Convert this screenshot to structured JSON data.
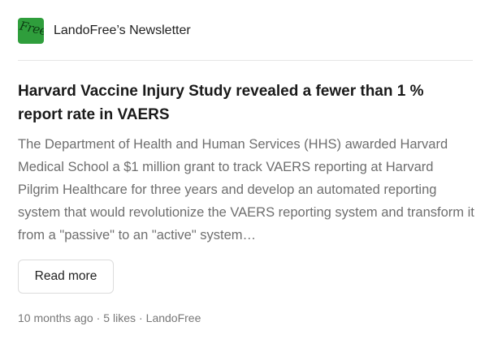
{
  "publication": {
    "logo_text": "Free",
    "name": "LandoFree’s Newsletter"
  },
  "post": {
    "title": "Harvard Vaccine Injury Study revealed a fewer than 1 % report rate in VAERS",
    "excerpt": "The Department of Health and Human Services (HHS) awarded Harvard Medical School a $1 million grant to track VAERS reporting at Harvard Pilgrim Healthcare for three years and develop an automated reporting system that would revolutionize the VAERS reporting system and transform it from a \"passive\" to an \"active\" system…",
    "read_more_label": "Read more",
    "meta": {
      "time": "10 months ago",
      "separator": "·",
      "likes": "5 likes",
      "author": "LandoFree"
    }
  },
  "colors": {
    "logo_bg": "#2f9e3c",
    "title": "#1a1a1a",
    "excerpt": "#6e6e6e",
    "meta": "#777777"
  }
}
